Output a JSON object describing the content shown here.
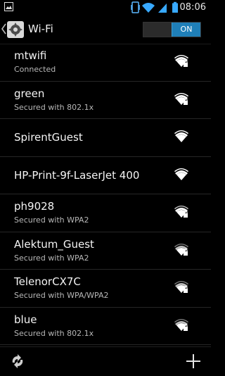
{
  "status_bar": {
    "time": "08:06",
    "icons": [
      "gallery-icon",
      "vibrate-icon",
      "wifi-icon",
      "signal-icon",
      "battery-icon"
    ]
  },
  "header": {
    "title": "Wi-Fi",
    "toggle_label": "ON"
  },
  "networks": [
    {
      "name": "mtwifi",
      "status": "Connected",
      "secured": true,
      "strength": "full"
    },
    {
      "name": "green",
      "status": "Secured with 802.1x",
      "secured": true,
      "strength": "full"
    },
    {
      "name": "SpirentGuest",
      "status": "",
      "secured": false,
      "strength": "full"
    },
    {
      "name": "HP-Print-9f-LaserJet 400",
      "status": "",
      "secured": false,
      "strength": "full"
    },
    {
      "name": "ph9028",
      "status": "Secured with WPA2",
      "secured": true,
      "strength": "high"
    },
    {
      "name": "Alektum_Guest",
      "status": "Secured with WPA2",
      "secured": true,
      "strength": "medium"
    },
    {
      "name": "TelenorCX7C",
      "status": "Secured with WPA/WPA2",
      "secured": true,
      "strength": "medium"
    },
    {
      "name": "blue",
      "status": "Secured with 802.1x",
      "secured": true,
      "strength": "medium"
    }
  ],
  "bottom_bar": {
    "left_icon": "refresh-icon",
    "right_icon": "add-icon"
  },
  "colors": {
    "accent": "#1f7fb8",
    "background": "#000000",
    "secondary_text": "#b7b7b7"
  }
}
